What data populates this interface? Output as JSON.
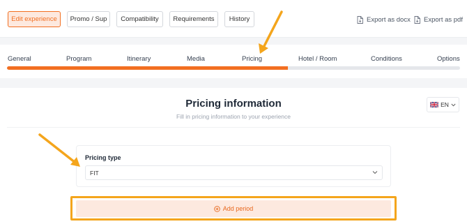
{
  "toolbar": {
    "buttons": [
      "Edit experience",
      "Promo / Sup",
      "Compatibility",
      "Requirements",
      "History"
    ],
    "export_docx": "Export as docx",
    "export_pdf": "Export as pdf"
  },
  "steps": {
    "items": [
      "General",
      "Program",
      "Itinerary",
      "Media",
      "Pricing",
      "Hotel / Room",
      "Conditions",
      "Options"
    ],
    "progress_percent": 62
  },
  "main": {
    "title": "Pricing information",
    "subtitle": "Fill in pricing information to your experience",
    "language": "EN",
    "pricing_type": {
      "label": "Pricing type",
      "value": "FIT"
    },
    "add_period_label": "Add period"
  },
  "colors": {
    "accent": "#f26f21",
    "accent_light": "#fde9df",
    "annotation": "#f4a51c"
  }
}
